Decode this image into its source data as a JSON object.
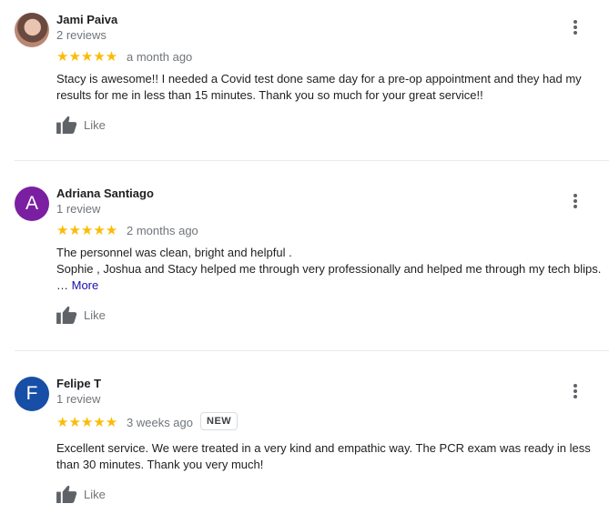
{
  "reviews": [
    {
      "name": "Jami Paiva",
      "count": "2 reviews",
      "rating": 5,
      "stars": "★★★★★",
      "when": "a month ago",
      "avatar_type": "photo",
      "lines": [
        "Stacy is awesome!! I needed a Covid test done same day for a pre-op appointment and they had my",
        "results for me in less than 15 minutes. Thank you so much for your great service!!"
      ],
      "like_label": "Like"
    },
    {
      "name": "Adriana Santiago",
      "count": "1 review",
      "rating": 5,
      "stars": "★★★★★",
      "when": "2 months ago",
      "avatar_letter": "A",
      "avatar_color": "#7b1fa2",
      "lines": [
        "The personnel was clean, bright and helpful .",
        "Sophie , Joshua and Stacy helped me through very professionally and helped me through my tech blips."
      ],
      "ellipsis": "…",
      "more_label": "More",
      "like_label": "Like"
    },
    {
      "name": "Felipe T",
      "count": "1 review",
      "rating": 5,
      "stars": "★★★★★",
      "when": "3 weeks ago",
      "badge": "NEW",
      "avatar_letter": "F",
      "avatar_color": "#174ea6",
      "lines": [
        "Excellent service. We were treated in a very kind and empathic way. The PCR exam was ready in less",
        "than 30 minutes. Thank you very much!"
      ],
      "like_label": "Like"
    }
  ],
  "icons": {
    "like": "thumbs-up-icon",
    "menu": "more-vert-icon"
  },
  "colors": {
    "star": "#fbbc04",
    "link": "#1a0dab",
    "secondary_text": "#70757a"
  }
}
